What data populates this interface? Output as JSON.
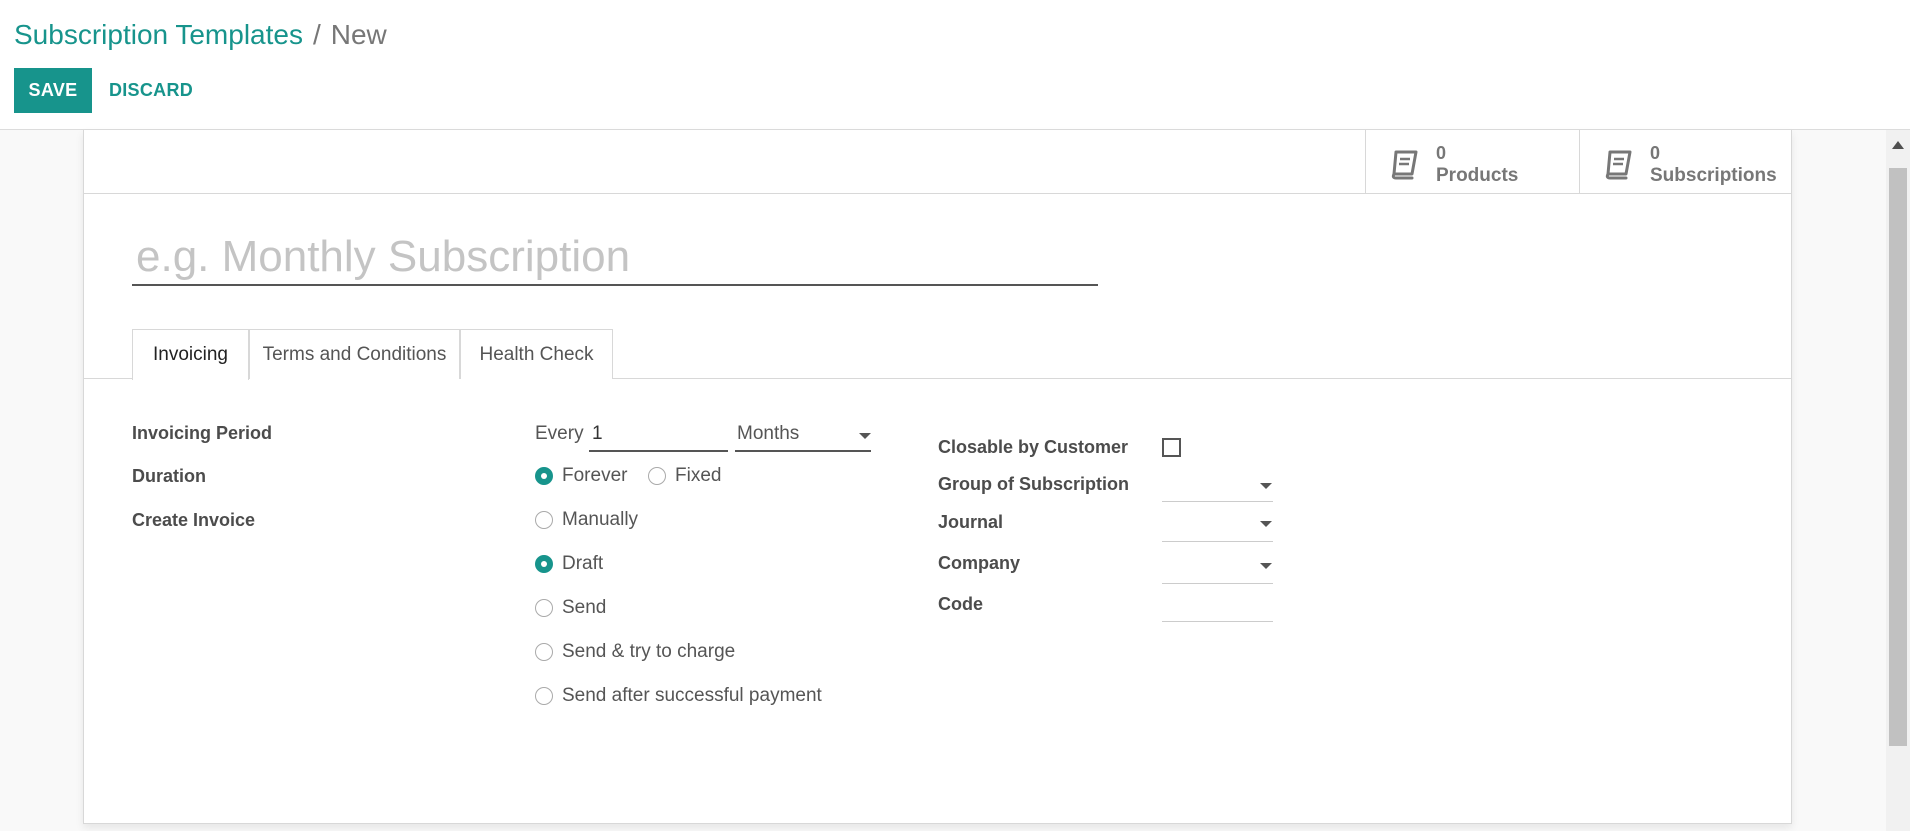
{
  "breadcrumb": {
    "parent": "Subscription Templates",
    "separator": "/",
    "current": "New"
  },
  "control_panel": {
    "save_label": "SAVE",
    "discard_label": "DISCARD"
  },
  "stat_buttons": [
    {
      "icon": "book-icon",
      "value": "0",
      "label": "Products"
    },
    {
      "icon": "book-icon",
      "value": "0",
      "label": "Subscriptions"
    }
  ],
  "form": {
    "name_placeholder": "e.g. Monthly Subscription",
    "tabs": [
      {
        "label": "Invoicing",
        "active": true
      },
      {
        "label": "Terms and Conditions",
        "active": false
      },
      {
        "label": "Health Check",
        "active": false
      }
    ],
    "invoicing_period": {
      "label": "Invoicing Period",
      "every_label": "Every",
      "interval": "1",
      "unit": "Months"
    },
    "duration": {
      "label": "Duration",
      "options": [
        {
          "label": "Forever",
          "checked": true
        },
        {
          "label": "Fixed",
          "checked": false
        }
      ]
    },
    "create_invoice": {
      "label": "Create Invoice",
      "options": [
        {
          "label": "Manually",
          "checked": false
        },
        {
          "label": "Draft",
          "checked": true
        },
        {
          "label": "Send",
          "checked": false
        },
        {
          "label": "Send & try to charge",
          "checked": false
        },
        {
          "label": "Send after successful payment",
          "checked": false
        }
      ]
    },
    "right": {
      "closable_label": "Closable by Customer",
      "group_label": "Group of Subscription",
      "journal_label": "Journal",
      "company_label": "Company",
      "code_label": "Code"
    }
  },
  "colors": {
    "brand": "#17948c",
    "text": "#4c4c4c",
    "muted": "#777777"
  }
}
